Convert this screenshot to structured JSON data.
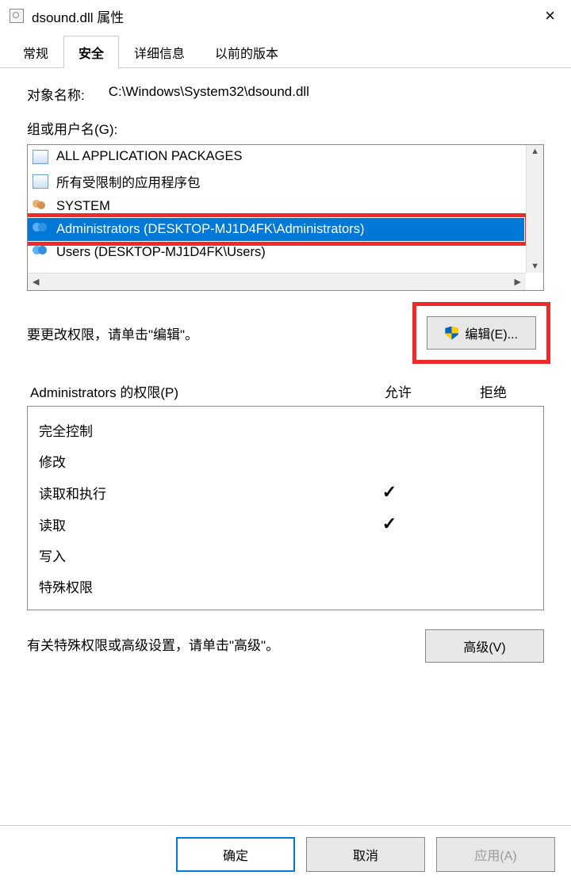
{
  "window": {
    "title": "dsound.dll 属性",
    "close": "×"
  },
  "tabs": {
    "general": "常规",
    "security": "安全",
    "details": "详细信息",
    "previous": "以前的版本"
  },
  "object": {
    "label": "对象名称:",
    "value": "C:\\Windows\\System32\\dsound.dll"
  },
  "groups": {
    "label": "组或用户名(G):",
    "items": [
      {
        "name": "ALL APPLICATION PACKAGES",
        "iconType": "pkg"
      },
      {
        "name": "所有受限制的应用程序包",
        "iconType": "pkg"
      },
      {
        "name": "SYSTEM",
        "iconType": "users"
      },
      {
        "name": "Administrators (DESKTOP-MJ1D4FK\\Administrators)",
        "iconType": "admin",
        "selected": true,
        "highlighted": true
      },
      {
        "name": "Users (DESKTOP-MJ1D4FK\\Users)",
        "iconType": "admin"
      }
    ]
  },
  "editPrompt": {
    "text": "要更改权限，请单击\"编辑\"。",
    "button": "编辑(E)..."
  },
  "permissions": {
    "header": "Administrators 的权限(P)",
    "allow": "允许",
    "deny": "拒绝",
    "rows": [
      {
        "name": "完全控制",
        "allow": false,
        "deny": false
      },
      {
        "name": "修改",
        "allow": false,
        "deny": false
      },
      {
        "name": "读取和执行",
        "allow": true,
        "deny": false
      },
      {
        "name": "读取",
        "allow": true,
        "deny": false
      },
      {
        "name": "写入",
        "allow": false,
        "deny": false
      },
      {
        "name": "特殊权限",
        "allow": false,
        "deny": false
      }
    ]
  },
  "advanced": {
    "text": "有关特殊权限或高级设置，请单击\"高级\"。",
    "button": "高级(V)"
  },
  "footer": {
    "ok": "确定",
    "cancel": "取消",
    "apply": "应用(A)"
  }
}
